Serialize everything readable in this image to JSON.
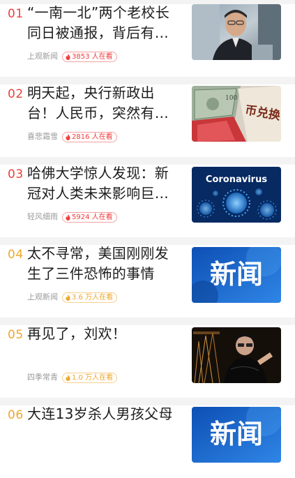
{
  "colors": {
    "rank_red": "#e8413d",
    "rank_orange": "#f0a62a",
    "rank_default": "#f0a62a",
    "badge_red": "#f03c3c",
    "badge_orange": "#f0a62a",
    "separator": "#f3f3f3"
  },
  "items": [
    {
      "rank": "01",
      "title": "“一南一北”两个老校长同日被通报，背后有…",
      "source": "上观新闻",
      "watching": "3853 人在看",
      "badge_style": "red",
      "thumb": "official-portrait-photo"
    },
    {
      "rank": "02",
      "title": "明天起，央行新政出台！人民币，突然有…",
      "source": "喜悲霜雪",
      "watching": "2816 人在看",
      "badge_style": "red",
      "thumb": "currency-exchange-photo",
      "thumb_text": "币兑换"
    },
    {
      "rank": "03",
      "title": "哈佛大学惊人发现：新冠对人类未来影响巨…",
      "source": "轻风细雨",
      "watching": "5924 人在看",
      "badge_style": "red",
      "thumb": "coronavirus-illustration",
      "thumb_text": "Coronavirus"
    },
    {
      "rank": "04",
      "title": "太不寻常，美国刚刚发生了三件恐怖的事情",
      "source": "上观新闻",
      "watching": "3.6 万人在看",
      "badge_style": "orange",
      "thumb": "news-banner",
      "thumb_text": "新闻"
    },
    {
      "rank": "05",
      "title": "再见了，刘欢！",
      "source": "四季常青",
      "watching": "1.0 万人在看",
      "badge_style": "orange",
      "thumb": "singer-stage-photo"
    },
    {
      "rank": "06",
      "title": "大连13岁杀人男孩父母",
      "source": "",
      "watching": "",
      "badge_style": "orange",
      "thumb": "news-banner",
      "thumb_text": "新闻"
    }
  ]
}
